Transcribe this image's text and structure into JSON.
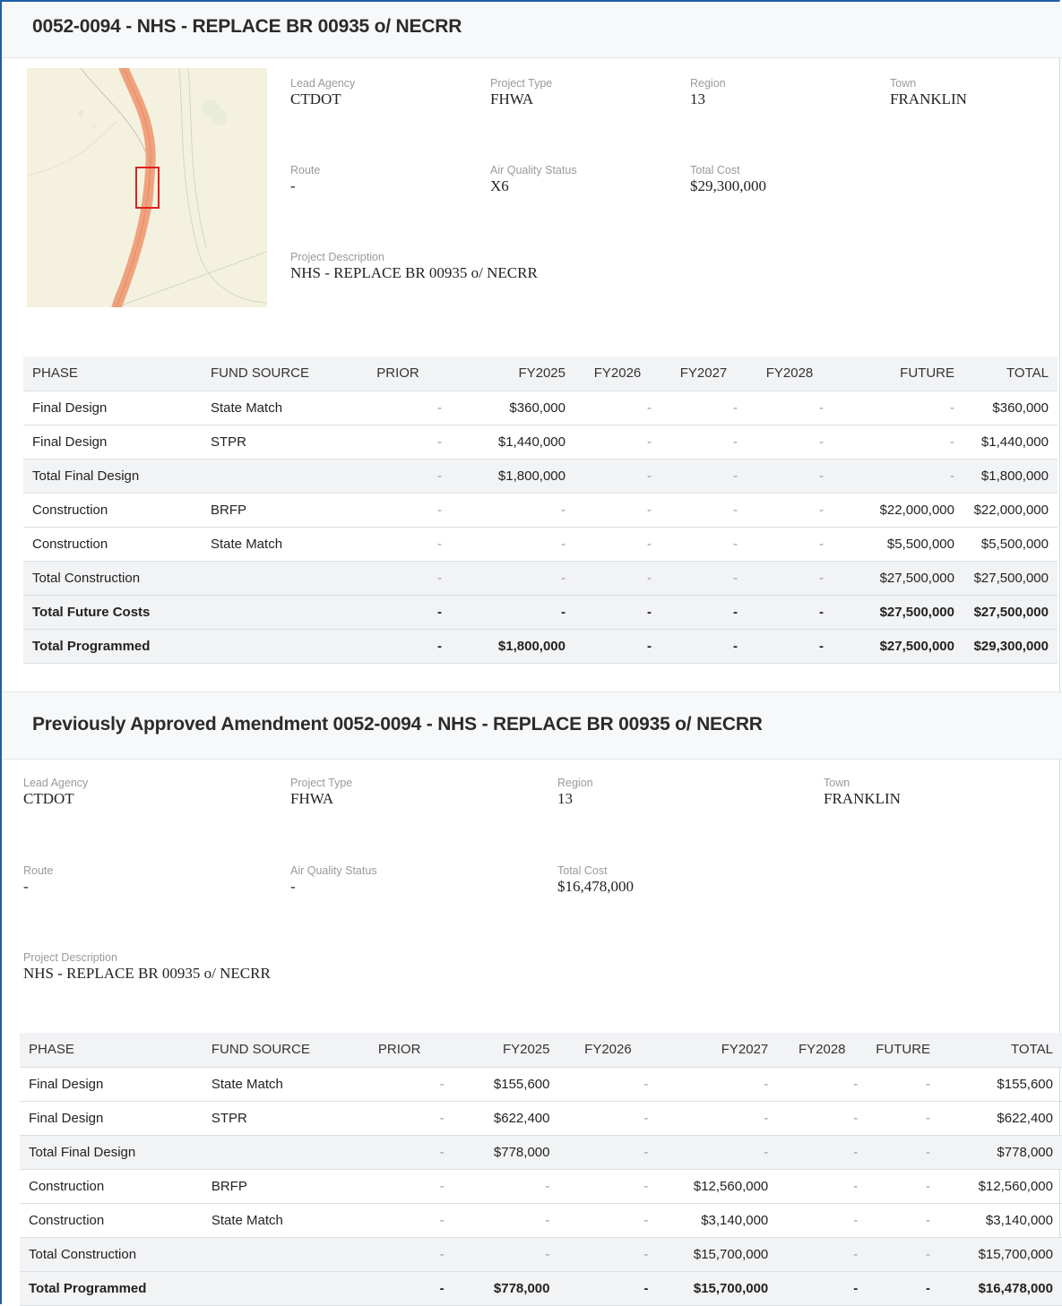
{
  "project": {
    "title": "0052-0094 - NHS - REPLACE BR 00935 o/ NECRR",
    "fields": {
      "lead_agency": {
        "label": "Lead Agency",
        "value": "CTDOT"
      },
      "project_type": {
        "label": "Project Type",
        "value": "FHWA"
      },
      "region": {
        "label": "Region",
        "value": "13"
      },
      "town": {
        "label": "Town",
        "value": "FRANKLIN"
      },
      "route": {
        "label": "Route",
        "value": "-"
      },
      "air_quality": {
        "label": "Air Quality Status",
        "value": "X6"
      },
      "total_cost": {
        "label": "Total Cost",
        "value": "$29,300,000"
      },
      "description": {
        "label": "Project Description",
        "value": "NHS - REPLACE BR 00935 o/ NECRR"
      }
    },
    "table": {
      "headers": [
        "PHASE",
        "FUND SOURCE",
        "PRIOR",
        "FY2025",
        "FY2026",
        "FY2027",
        "FY2028",
        "FUTURE",
        "TOTAL"
      ],
      "rows": [
        [
          "Final Design",
          "State Match",
          "-",
          "$360,000",
          "-",
          "-",
          "-",
          "-",
          "$360,000"
        ],
        [
          "Final Design",
          "STPR",
          "-",
          "$1,440,000",
          "-",
          "-",
          "-",
          "-",
          "$1,440,000"
        ],
        [
          "Total Final Design",
          "",
          "-",
          "$1,800,000",
          "-",
          "-",
          "-",
          "-",
          "$1,800,000"
        ],
        [
          "Construction",
          "BRFP",
          "-",
          "-",
          "-",
          "-",
          "-",
          "$22,000,000",
          "$22,000,000"
        ],
        [
          "Construction",
          "State Match",
          "-",
          "-",
          "-",
          "-",
          "-",
          "$5,500,000",
          "$5,500,000"
        ],
        [
          "Total Construction",
          "",
          "-",
          "-",
          "-",
          "-",
          "-",
          "$27,500,000",
          "$27,500,000"
        ],
        [
          "Total Future Costs",
          "",
          "-",
          "-",
          "-",
          "-",
          "-",
          "$27,500,000",
          "$27,500,000"
        ],
        [
          "Total Programmed",
          "",
          "-",
          "$1,800,000",
          "-",
          "-",
          "-",
          "$27,500,000",
          "$29,300,000"
        ]
      ]
    }
  },
  "amendment": {
    "title": "Previously Approved Amendment 0052-0094 - NHS - REPLACE BR 00935 o/ NECRR",
    "fields": {
      "lead_agency": {
        "label": "Lead Agency",
        "value": "CTDOT"
      },
      "project_type": {
        "label": "Project Type",
        "value": "FHWA"
      },
      "region": {
        "label": "Region",
        "value": "13"
      },
      "town": {
        "label": "Town",
        "value": "FRANKLIN"
      },
      "route": {
        "label": "Route",
        "value": "-"
      },
      "air_quality": {
        "label": "Air Quality Status",
        "value": "-"
      },
      "total_cost": {
        "label": "Total Cost",
        "value": "$16,478,000"
      },
      "description": {
        "label": "Project Description",
        "value": "NHS - REPLACE BR 00935 o/ NECRR"
      }
    },
    "table": {
      "headers": [
        "PHASE",
        "FUND SOURCE",
        "PRIOR",
        "FY2025",
        "FY2026",
        "FY2027",
        "FY2028",
        "FUTURE",
        "TOTAL"
      ],
      "rows": [
        [
          "Final Design",
          "State Match",
          "-",
          "$155,600",
          "-",
          "-",
          "-",
          "-",
          "$155,600"
        ],
        [
          "Final Design",
          "STPR",
          "-",
          "$622,400",
          "-",
          "-",
          "-",
          "-",
          "$622,400"
        ],
        [
          "Total Final Design",
          "",
          "-",
          "$778,000",
          "-",
          "-",
          "-",
          "-",
          "$778,000"
        ],
        [
          "Construction",
          "BRFP",
          "-",
          "-",
          "-",
          "$12,560,000",
          "-",
          "-",
          "$12,560,000"
        ],
        [
          "Construction",
          "State Match",
          "-",
          "-",
          "-",
          "$3,140,000",
          "-",
          "-",
          "$3,140,000"
        ],
        [
          "Total Construction",
          "",
          "-",
          "-",
          "-",
          "$15,700,000",
          "-",
          "-",
          "$15,700,000"
        ],
        [
          "Total Programmed",
          "",
          "-",
          "$778,000",
          "-",
          "$15,700,000",
          "-",
          "-",
          "$16,478,000"
        ]
      ]
    }
  },
  "map": {
    "icon": "project-location-map",
    "highlight_color": "#e02020",
    "road_color": "#f0a27e"
  }
}
